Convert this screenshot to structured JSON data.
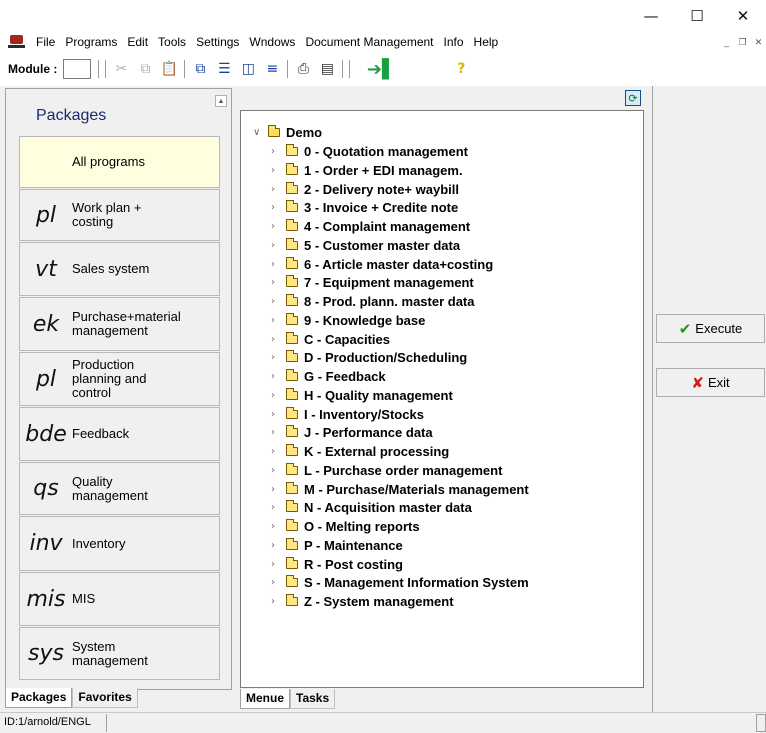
{
  "window": {
    "controls": {
      "minimize": "—",
      "maximize": "☐",
      "close": "✕"
    }
  },
  "menubar": {
    "items": [
      "File",
      "Programs",
      "Edit",
      "Tools",
      "Settings",
      "Wndows",
      "Document Management",
      "Info",
      "Help"
    ]
  },
  "toolbar": {
    "module_label": "Module :",
    "module_value": "",
    "help_glyph": "?"
  },
  "packages": {
    "title": "Packages",
    "items": [
      {
        "abbr": "",
        "name": "All programs"
      },
      {
        "abbr": "pl",
        "name": "Work plan +\ncosting"
      },
      {
        "abbr": "vt",
        "name": "Sales system"
      },
      {
        "abbr": "ek",
        "name": "Purchase+material\nmanagement"
      },
      {
        "abbr": "pl",
        "name": "Production\nplanning and\ncontrol"
      },
      {
        "abbr": "bde",
        "name": "Feedback"
      },
      {
        "abbr": "qs",
        "name": "Quality\nmanagement"
      },
      {
        "abbr": "inv",
        "name": "Inventory"
      },
      {
        "abbr": "mis",
        "name": "MIS"
      },
      {
        "abbr": "sys",
        "name": "System\nmanagement"
      }
    ],
    "tabs": [
      "Packages",
      "Favorites"
    ]
  },
  "tree": {
    "root": "Demo",
    "items": [
      "0 - Quotation management",
      "1 - Order + EDI managem.",
      "2 - Delivery note+ waybill",
      "3 - Invoice + Credite note",
      "4 - Complaint management",
      "5 - Customer master data",
      "6 - Article master data+costing",
      "7 - Equipment management",
      "8 - Prod. plann. master data",
      "9 - Knowledge base",
      "C - Capacities",
      "D - Production/Scheduling",
      "G - Feedback",
      "H - Quality management",
      "I - Inventory/Stocks",
      "J - Performance data",
      "K - External processing",
      "L - Purchase order management",
      "M - Purchase/Materials management",
      "N - Acquisition master data",
      "O - Melting  reports",
      "P - Maintenance",
      "R - Post costing",
      "S - Management Information System",
      "Z - System management"
    ],
    "tabs": [
      "Menue",
      "Tasks"
    ]
  },
  "actions": {
    "execute": "Execute",
    "exit": "Exit"
  },
  "status": {
    "text": "ID:1/arnold/ENGL"
  }
}
